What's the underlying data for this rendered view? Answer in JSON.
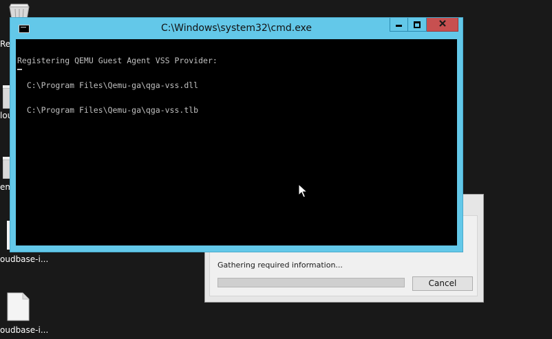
{
  "desktop": {
    "icons": [
      {
        "label": "Rec"
      },
      {
        "label": "lou"
      },
      {
        "label": "em"
      },
      {
        "label": "oudbase-i..."
      },
      {
        "label": "oudbase-i..."
      }
    ]
  },
  "dialog": {
    "status_text": "Gathering required information...",
    "progress": 0,
    "cancel_label": "Cancel"
  },
  "console": {
    "title": "C:\\Windows\\system32\\cmd.exe",
    "lines": [
      "Registering QEMU Guest Agent VSS Provider:",
      "  C:\\Program Files\\Qemu-ga\\qga-vss.dll",
      "  C:\\Program Files\\Qemu-ga\\qga-vss.tlb"
    ]
  },
  "colors": {
    "titlebar": "#63c8e9",
    "close_button": "#c75050",
    "console_background": "#000000",
    "console_text": "#c0c0c0",
    "desktop": "#191919"
  },
  "icons": [
    "recycle-bin-icon",
    "document-icon",
    "cmd-app-icon",
    "minimize-icon",
    "maximize-icon",
    "close-icon",
    "mouse-pointer-icon"
  ]
}
